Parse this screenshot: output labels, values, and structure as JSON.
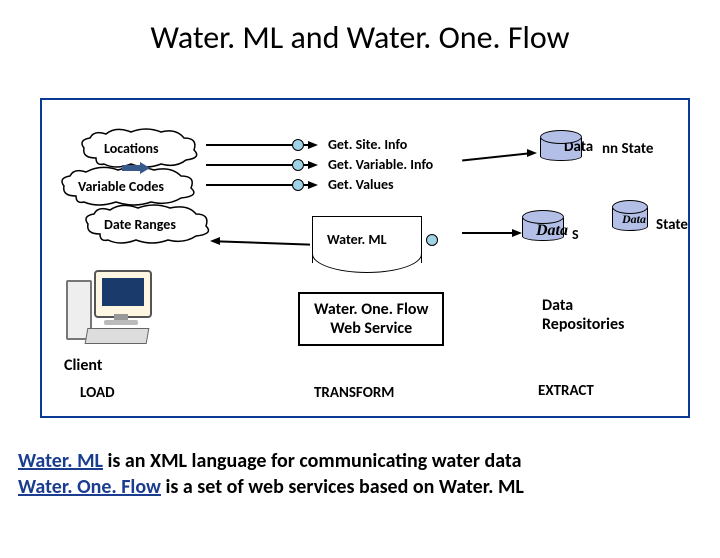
{
  "title": "Water. ML and Water. One. Flow",
  "diagram": {
    "cloud1": "Locations",
    "cloud2": "Variable Codes",
    "cloud3": "Date Ranges",
    "ws_methods": [
      "Get. Site. Info",
      "Get. Variable. Info",
      "Get. Values"
    ],
    "waterml_doc": "Water. ML",
    "service_box_line1": "Water. One. Flow",
    "service_box_line2": "Web Service",
    "repo1_label": "Data",
    "repo1_suffix": "nn State",
    "repo2_label": "Data",
    "repo2_suffix": "S",
    "repo3_label": "Data",
    "repo3_suffix": "State",
    "repos_caption": "Data\nRepositories",
    "client_label": "Client",
    "load_label": "LOAD",
    "transform_label": "TRANSFORM",
    "extract_label": "EXTRACT"
  },
  "footer": {
    "line1_a": "Water. ML",
    "line1_b": " is an XML language for communicating water data",
    "line2_a": "Water. One. Flow",
    "line2_b": " is a set of web services based on Water. ML"
  }
}
